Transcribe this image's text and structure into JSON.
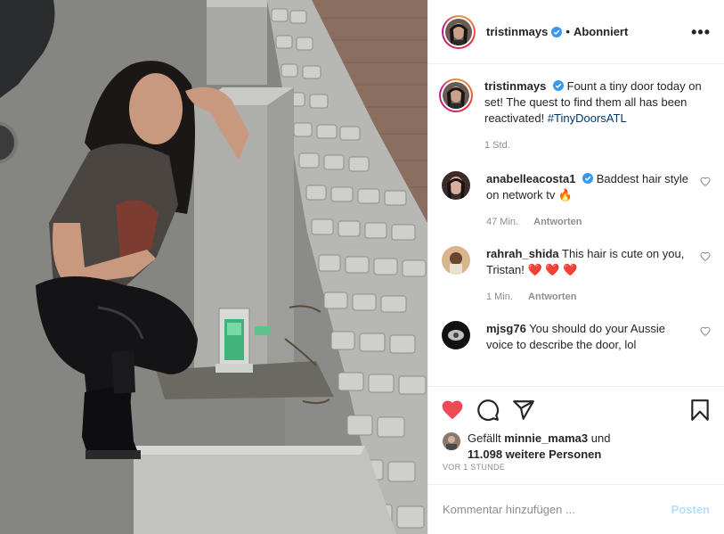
{
  "header": {
    "username": "tristinmays",
    "separator": "•",
    "follow_status": "Abonniert",
    "more_icon": "more-horizontal-icon"
  },
  "caption": {
    "username": "tristinmays",
    "text": "Fount a tiny door today on set! The quest to find them all has been reactivated!",
    "hashtag": "#TinyDoorsATL",
    "time": "1 Std."
  },
  "comments": [
    {
      "username": "anabelleacosta1",
      "verified": true,
      "text": "Baddest hair style on network tv 🔥",
      "time": "47 Min.",
      "reply": "Antworten"
    },
    {
      "username": "rahrah_shida",
      "verified": false,
      "text": "This hair is cute on you, Tristan! ❤️ ❤️ ❤️",
      "time": "1 Min.",
      "reply": "Antworten"
    },
    {
      "username": "mjsg76",
      "verified": false,
      "text": "You should do your Aussie voice to describe the door, lol"
    }
  ],
  "likes": {
    "prefix": "Gefällt ",
    "first_user": "minnie_mama3",
    "middle": " und",
    "rest": "11.098 weitere Personen"
  },
  "timestamp": "VOR 1 STUNDE",
  "comment_box": {
    "placeholder": "Kommentar hinzufügen ...",
    "post_label": "Posten"
  },
  "colors": {
    "like_active": "#ed4956",
    "link": "#00376b",
    "muted": "#8e8e8e",
    "post_disabled": "#b2dffc",
    "verified": "#3897f0"
  }
}
